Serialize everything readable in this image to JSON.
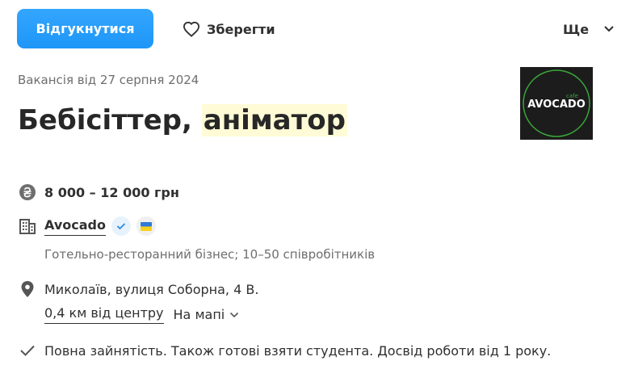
{
  "actions": {
    "apply_label": "Відгукнутися",
    "save_label": "Зберегти",
    "more_label": "Ще"
  },
  "vacancy": {
    "posted": "Вакансія від 27 серпня 2024",
    "title_part1": "Бебісіттер, ",
    "title_part2": "аніматор",
    "salary": "8 000 – 12 000 грн",
    "company_name": "Avocado",
    "industry": "Готельно-ресторанний бізнес; 10–50 співробітників",
    "address": "Миколаїв, вулиця Соборна, 4 В.",
    "distance": "0,4 км від центру",
    "map_label": "На мапі",
    "employment": "Повна зайнятість. Також готові взяти студента. Досвід роботи від 1 року."
  },
  "logo": {
    "small_text": "cafe",
    "brand_text": "AVOCADO"
  },
  "icons": {
    "save": "heart-icon",
    "more": "chevron-down-icon",
    "salary": "hryvnia-icon",
    "company": "building-icon",
    "verified": "check-badge-icon",
    "flag": "ukraine-flag-icon",
    "address": "location-pin-icon",
    "map": "chevron-down-icon",
    "employment": "checkmark-icon"
  },
  "colors": {
    "accent": "#2aa0ff",
    "highlight": "#fffbd6",
    "muted": "#6e6e6e",
    "text": "#303030",
    "logo_bg": "#1c1c1c",
    "logo_green": "#3aa63a"
  }
}
